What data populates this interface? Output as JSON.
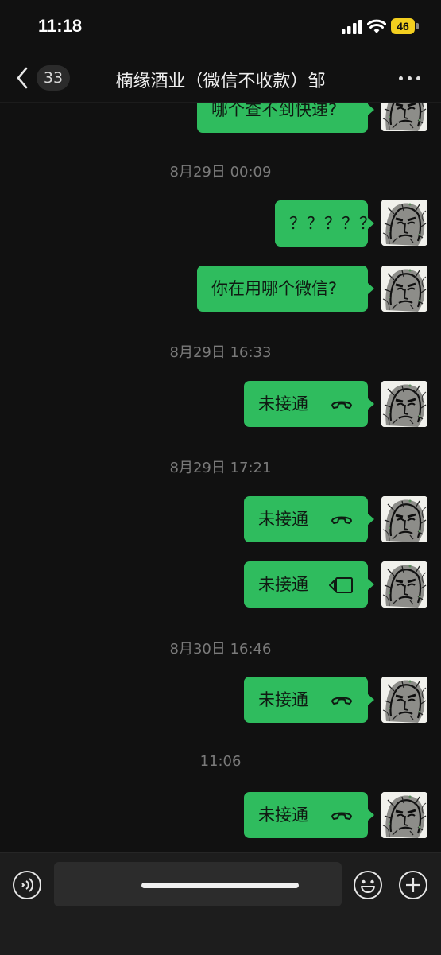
{
  "status_bar": {
    "time": "11:18",
    "battery": "46"
  },
  "nav": {
    "unread_count": "33",
    "title": "楠缘酒业（微信不收款）邹"
  },
  "messages": [
    {
      "type": "text",
      "text": "哪个查不到快递?"
    },
    {
      "type": "timestamp",
      "text": "8月29日 00:09"
    },
    {
      "type": "text",
      "text": "？？？？？"
    },
    {
      "type": "text",
      "text": "你在用哪个微信?"
    },
    {
      "type": "timestamp",
      "text": "8月29日 16:33"
    },
    {
      "type": "call",
      "text": "未接通",
      "call_kind": "voice",
      "icon": "phone-hangup-icon"
    },
    {
      "type": "timestamp",
      "text": "8月29日 17:21"
    },
    {
      "type": "call",
      "text": "未接通",
      "call_kind": "voice",
      "icon": "phone-hangup-icon"
    },
    {
      "type": "call",
      "text": "未接通",
      "call_kind": "video",
      "icon": "video-camera-icon"
    },
    {
      "type": "timestamp",
      "text": "8月30日 16:46"
    },
    {
      "type": "call",
      "text": "未接通",
      "call_kind": "voice",
      "icon": "phone-hangup-icon"
    },
    {
      "type": "timestamp",
      "text": "11:06"
    },
    {
      "type": "call",
      "text": "未接通",
      "call_kind": "voice",
      "icon": "phone-hangup-icon"
    }
  ],
  "input_bar": {
    "placeholder": "",
    "icons": [
      "voice-icon",
      "emoji-icon",
      "plus-icon"
    ]
  },
  "colors": {
    "background": "#111111",
    "bubble": "#2fbc5e",
    "timestamp": "#7a7a7a",
    "input_bar": "#1d1d1d"
  }
}
